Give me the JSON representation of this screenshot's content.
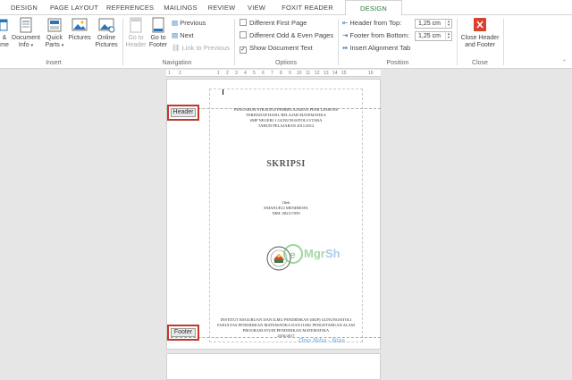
{
  "tabs": [
    "DESIGN",
    "PAGE LAYOUT",
    "REFERENCES",
    "MAILINGS",
    "REVIEW",
    "VIEW",
    "FOXIT READER PDF",
    "DESIGN"
  ],
  "ribbon": {
    "insert": {
      "group_label": "Insert",
      "date_time_label": "& me",
      "document_info_label": "Document",
      "document_info_label2": "Info",
      "quick_parts_label": "Quick",
      "quick_parts_label2": "Parts",
      "pictures_label": "Pictures",
      "online_pictures_label": "Online",
      "online_pictures_label2": "Pictures"
    },
    "navigation": {
      "group_label": "Navigation",
      "go_to_header_label": "Go to",
      "go_to_header_label2": "Header",
      "go_to_footer_label": "Go to",
      "go_to_footer_label2": "Footer",
      "previous_label": "Previous",
      "next_label": "Next",
      "link_to_previous_label": "Link to Previous"
    },
    "options": {
      "group_label": "Options",
      "different_first_page": {
        "label": "Different First Page",
        "checked": false
      },
      "different_odd_even": {
        "label": "Different Odd & Even Pages",
        "checked": false
      },
      "show_document_text": {
        "label": "Show Document Text",
        "checked": true
      }
    },
    "position": {
      "group_label": "Position",
      "header_from_top_label": "Header from Top:",
      "header_from_top_value": "1,25 cm",
      "footer_from_bottom_label": "Footer from Bottom:",
      "footer_from_bottom_value": "1,25 cm",
      "insert_alignment_tab_label": "Insert Alignment Tab"
    },
    "close": {
      "group_label": "Close",
      "close_label": "Close Header",
      "close_label2": "and Footer"
    }
  },
  "ruler": {
    "marks": [
      "1",
      "2",
      "1",
      "2",
      "3",
      "4",
      "5",
      "6",
      "7",
      "8",
      "9",
      "10",
      "11",
      "12",
      "13",
      "14",
      "15",
      "16"
    ]
  },
  "document": {
    "header_tag": "Header",
    "footer_tag": "Footer",
    "title_lines": [
      "PENGARUH STRATEGI PEMBELAJARAN PEER LESSONS",
      "TERHADAP HASIL BELAJAR MATEMATIKA",
      "SMP NEGERI 1 GUNUNGSITOLI UTARA",
      "TAHUN PELAJARAN 2011/2012"
    ],
    "heading": "SKRIPSI",
    "author_lines": [
      "Oleh",
      "EMANUELI MENDROFA",
      "NIM. 082117059"
    ],
    "institution_lines": [
      "INSTITUT KEGURUAN DAN ILMU PENDIDIKAN (IKIP) GUNUNGSITOLI",
      "FAKULTAS PENDIDIKAN MATEMATIKA DAN ILMU PENGETAHUAN ALAM",
      "PROGRAM STUDI PENDIDIKAN MATEMATIKA",
      "2016/2017"
    ],
    "watermark_text": "Ono Niha - Nias"
  },
  "colors": {
    "accent": "#2b7a3a",
    "close_red": "#d9412f",
    "highlight": "#c0392b"
  }
}
